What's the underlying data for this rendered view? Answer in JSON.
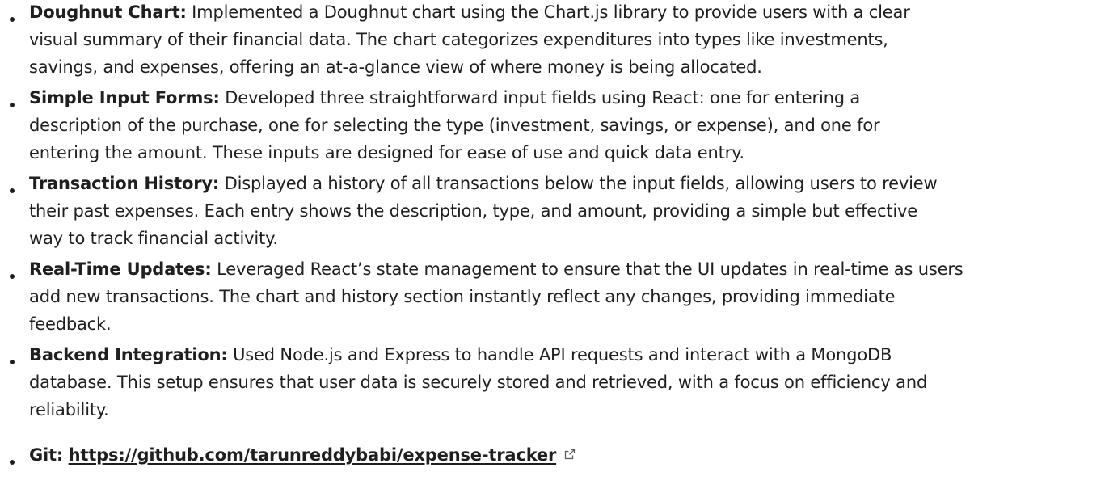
{
  "features": [
    {
      "label": "Doughnut Chart:",
      "lines": [
        " Implemented a Doughnut chart using the Chart.js library to provide users with a clear",
        "visual summary of their financial data. The chart categorizes expenditures into types like investments,",
        "savings, and expenses, offering an at-a-glance view of where money is being allocated."
      ]
    },
    {
      "label": "Simple Input Forms:",
      "lines": [
        " Developed three straightforward input fields using React: one for entering a",
        "description of the purchase, one for selecting the type (investment, savings, or expense), and one for",
        "entering the amount. These inputs are designed for ease of use and quick data entry."
      ]
    },
    {
      "label": "Transaction History:",
      "lines": [
        " Displayed a history of all transactions below the input fields, allowing users to review",
        "their past expenses. Each entry shows the description, type, and amount, providing a simple but effective",
        "way to track financial activity."
      ]
    },
    {
      "label": "Real-Time Updates:",
      "lines": [
        " Leveraged React’s state management to ensure that the UI updates in real-time as users",
        "add new transactions. The chart and history section instantly reflect any changes, providing immediate",
        "feedback."
      ]
    },
    {
      "label": "Backend Integration:",
      "lines": [
        " Used Node.js and Express to handle API requests and interact with a MongoDB",
        "database. This setup ensures that user data is securely stored and retrieved, with a focus on efficiency and",
        "reliability."
      ]
    }
  ],
  "git": {
    "label": "Git:",
    "url_text": "https://github.com/tarunreddybabi/expense-tracker",
    "icon": "external-link-icon"
  }
}
